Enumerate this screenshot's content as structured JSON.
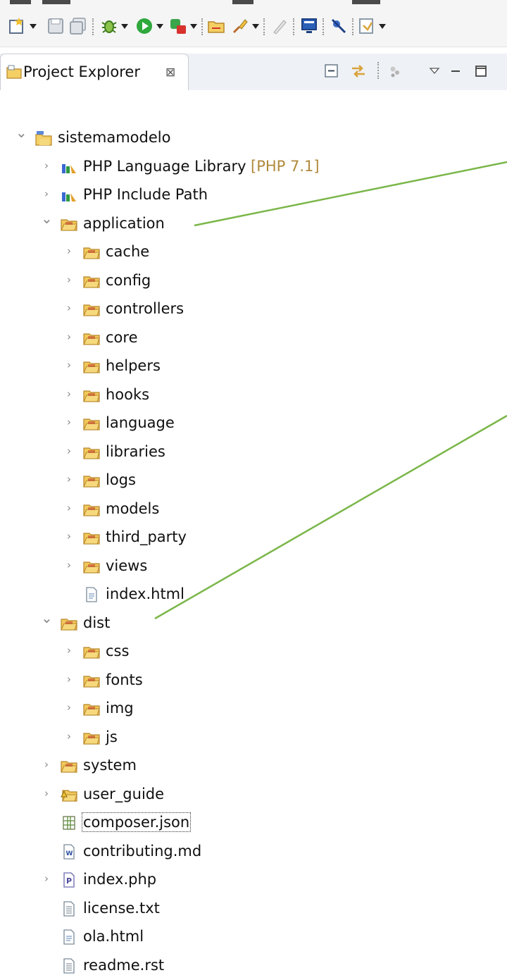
{
  "toolbar": {
    "items": [
      {
        "icon": "new-wizard-icon",
        "label": "New",
        "dropdown": true
      },
      {
        "icon": "save-icon",
        "label": "Save"
      },
      {
        "icon": "save-all-icon",
        "label": "Save All"
      },
      {
        "icon": "debug-icon",
        "label": "Debug",
        "dropdown": true
      },
      {
        "icon": "run-icon",
        "label": "Run",
        "dropdown": true
      },
      {
        "icon": "external-tools-icon",
        "label": "External Tools",
        "dropdown": true
      },
      {
        "icon": "open-type-icon",
        "label": "Open Type"
      },
      {
        "icon": "search-brush-icon",
        "label": "Search",
        "dropdown": true
      },
      {
        "icon": "pen-icon",
        "label": "Toggle Mark Occurrences"
      },
      {
        "icon": "monitor-icon",
        "label": "Show Console"
      },
      {
        "icon": "skip-breakpoints-icon",
        "label": "Skip All Breakpoints"
      },
      {
        "icon": "next-annotation-icon",
        "label": "Next Annotation",
        "dropdown": true
      }
    ]
  },
  "view": {
    "title": "Project Explorer",
    "close_glyph": "⊠",
    "icon": "project-explorer-icon",
    "buttons": [
      "collapse-all-icon",
      "link-with-editor-icon",
      "filter-icon",
      "view-menu-icon",
      "minimize-icon",
      "maximize-icon"
    ]
  },
  "tree": [
    {
      "label": "sistemamodelo",
      "icon": "php-project-icon",
      "level": 0,
      "twisty": "expanded"
    },
    {
      "label": "PHP Language Library",
      "suffix": "[PHP 7.1]",
      "icon": "library-icon",
      "level": 1,
      "twisty": "collapsed"
    },
    {
      "label": "PHP Include Path",
      "icon": "library-icon",
      "level": 1,
      "twisty": "collapsed"
    },
    {
      "label": "application",
      "icon": "folder-icon",
      "level": 1,
      "twisty": "expanded"
    },
    {
      "label": "cache",
      "icon": "folder-icon",
      "level": 2,
      "twisty": "collapsed"
    },
    {
      "label": "config",
      "icon": "folder-icon",
      "level": 2,
      "twisty": "collapsed"
    },
    {
      "label": "controllers",
      "icon": "folder-icon",
      "level": 2,
      "twisty": "collapsed"
    },
    {
      "label": "core",
      "icon": "folder-icon",
      "level": 2,
      "twisty": "collapsed"
    },
    {
      "label": "helpers",
      "icon": "folder-icon",
      "level": 2,
      "twisty": "collapsed"
    },
    {
      "label": "hooks",
      "icon": "folder-icon",
      "level": 2,
      "twisty": "collapsed"
    },
    {
      "label": "language",
      "icon": "folder-icon",
      "level": 2,
      "twisty": "collapsed"
    },
    {
      "label": "libraries",
      "icon": "folder-icon",
      "level": 2,
      "twisty": "collapsed"
    },
    {
      "label": "logs",
      "icon": "folder-icon",
      "level": 2,
      "twisty": "collapsed"
    },
    {
      "label": "models",
      "icon": "folder-icon",
      "level": 2,
      "twisty": "collapsed"
    },
    {
      "label": "third_party",
      "icon": "folder-icon",
      "level": 2,
      "twisty": "collapsed"
    },
    {
      "label": "views",
      "icon": "folder-icon",
      "level": 2,
      "twisty": "collapsed"
    },
    {
      "label": "index.html",
      "icon": "html-file-icon",
      "level": 2,
      "twisty": "none"
    },
    {
      "label": "dist",
      "icon": "folder-icon",
      "level": 1,
      "twisty": "expanded"
    },
    {
      "label": "css",
      "icon": "folder-icon",
      "level": 2,
      "twisty": "collapsed"
    },
    {
      "label": "fonts",
      "icon": "folder-icon",
      "level": 2,
      "twisty": "collapsed"
    },
    {
      "label": "img",
      "icon": "folder-icon",
      "level": 2,
      "twisty": "collapsed"
    },
    {
      "label": "js",
      "icon": "folder-icon",
      "level": 2,
      "twisty": "collapsed"
    },
    {
      "label": "system",
      "icon": "folder-icon",
      "level": 1,
      "twisty": "collapsed"
    },
    {
      "label": "user_guide",
      "icon": "folder-warning-icon",
      "level": 1,
      "twisty": "collapsed"
    },
    {
      "label": "composer.json",
      "icon": "json-file-icon",
      "level": 1,
      "twisty": "none",
      "selected": true
    },
    {
      "label": "contributing.md",
      "icon": "markdown-file-icon",
      "level": 1,
      "twisty": "none"
    },
    {
      "label": "index.php",
      "icon": "php-file-icon",
      "level": 1,
      "twisty": "collapsed"
    },
    {
      "label": "license.txt",
      "icon": "text-file-icon",
      "level": 1,
      "twisty": "none"
    },
    {
      "label": "ola.html",
      "icon": "html-file-icon",
      "level": 1,
      "twisty": "none"
    },
    {
      "label": "readme.rst",
      "icon": "text-file-icon",
      "level": 1,
      "twisty": "none"
    }
  ],
  "colors": {
    "folder": "#e8b84a",
    "annotation_line": "#7ab648",
    "decoration": "#b08a3a"
  }
}
